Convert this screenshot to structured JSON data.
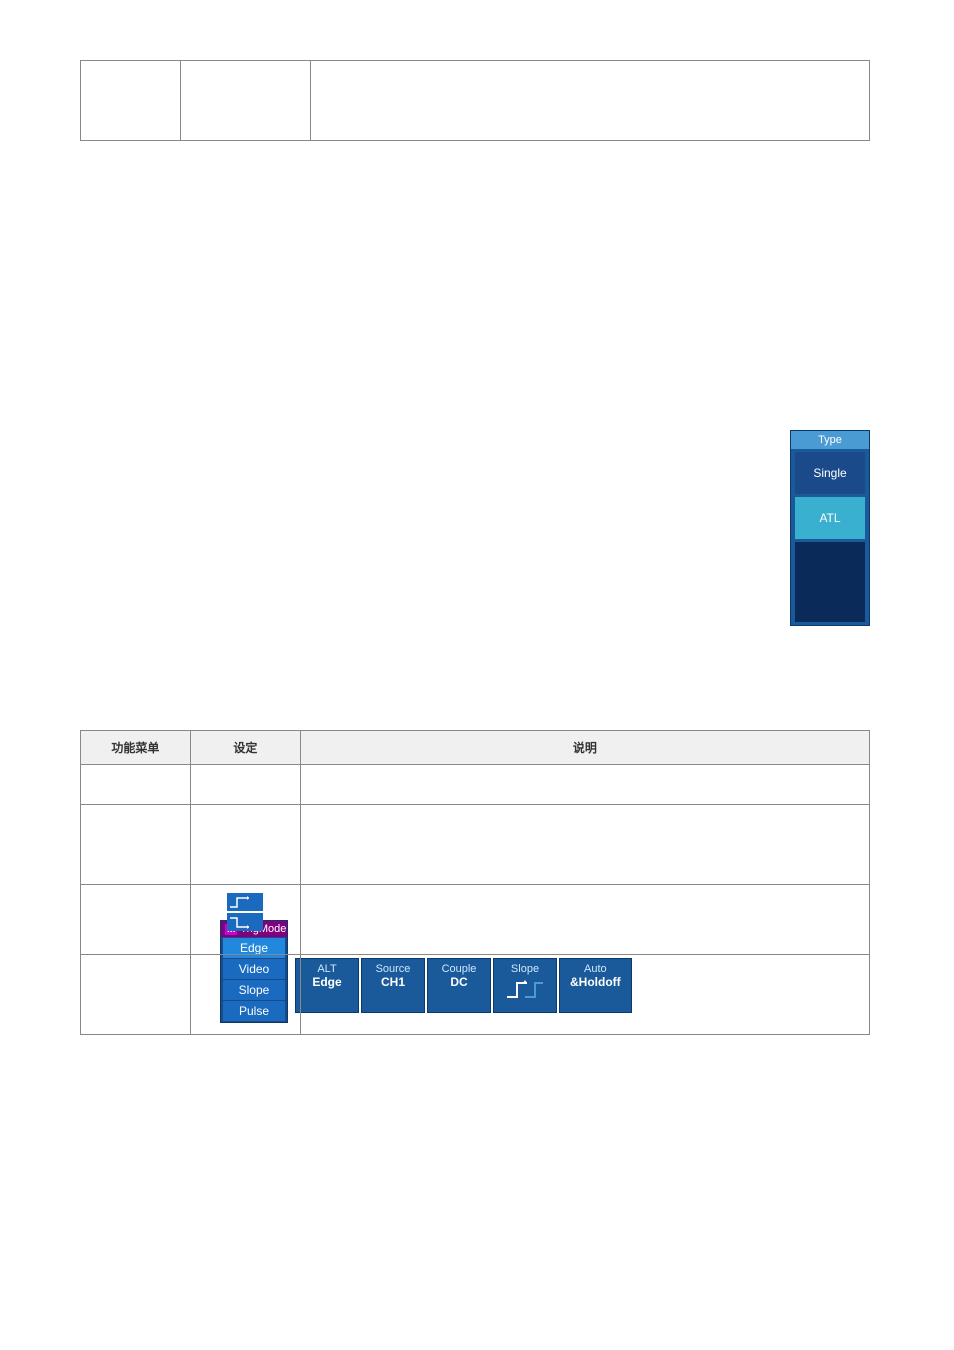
{
  "topTable": {
    "rows": [
      {
        "col1": "",
        "col2": "",
        "col3": ""
      }
    ]
  },
  "trigMenu": {
    "title": "TrigMode",
    "badge": "M",
    "items": [
      "Edge",
      "Video",
      "Slope",
      "Pulse"
    ]
  },
  "trigBar": {
    "buttons": [
      {
        "top": "ALT",
        "bottom": "Edge"
      },
      {
        "top": "Source",
        "bottom": "CH1"
      },
      {
        "top": "Couple",
        "bottom": "DC"
      },
      {
        "top": "Slope",
        "bottom": ""
      },
      {
        "top": "Auto",
        "bottom": "&Holdoff"
      }
    ]
  },
  "rightPanel": {
    "title": "Type",
    "buttons": [
      "Single",
      "ATL"
    ]
  },
  "bottomTable": {
    "headers": [
      "功能菜单",
      "设定",
      "说明"
    ],
    "rows": [
      {
        "col1": "",
        "col2": "",
        "col3": ""
      },
      {
        "col1": "",
        "col2": "",
        "col3": ""
      },
      {
        "col1": "",
        "col2": "slope_icons",
        "col3": ""
      },
      {
        "col1": "",
        "col2": "",
        "col3": ""
      }
    ]
  },
  "colors": {
    "trigMenuBg": "#1a4a8a",
    "trigMenuTitle": "#800080",
    "trigBtnBg": "#1a5a9a",
    "rightPanelAccent": "#3ab0d0"
  }
}
